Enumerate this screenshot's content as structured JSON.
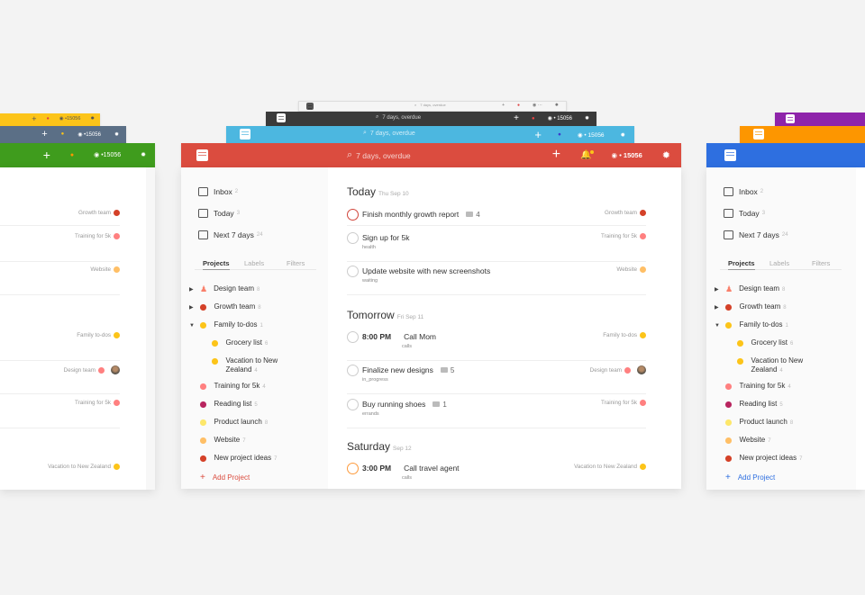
{
  "app": {
    "search_placeholder": "7 days, overdue",
    "karma": "15056",
    "karma_prefix": "•",
    "icons": [
      "logo-icon",
      "search-icon",
      "plus-icon",
      "bell-icon",
      "karma-icon",
      "gear-icon"
    ]
  },
  "theme_colors": {
    "red": "#db4c3f",
    "light": "#f5f5f5",
    "dark": "#3a3a3a",
    "sky": "#4cb7e0",
    "yellow": "#fcc419",
    "slate": "#5b6f86",
    "green": "#3f9c1d",
    "purple": "#8e24aa",
    "orange": "#fd9600",
    "blue": "#2e6fe0"
  },
  "sidebar": {
    "nav": [
      {
        "label": "Inbox",
        "count": "2",
        "icon": "inbox-icon"
      },
      {
        "label": "Today",
        "count": "3",
        "icon": "calendar-icon"
      },
      {
        "label": "Next 7 days",
        "count": "24",
        "icon": "calendar-week-icon"
      }
    ],
    "tabs": [
      "Projects",
      "Labels",
      "Filters"
    ],
    "projects": [
      {
        "label": "Design team",
        "count": "8",
        "color": "#f9806b",
        "expand": "collapsed",
        "shared": true
      },
      {
        "label": "Growth team",
        "count": "8",
        "color": "#d44128",
        "expand": "collapsed"
      },
      {
        "label": "Family to-dos",
        "count": "1",
        "color": "#fcc419",
        "expand": "expanded"
      },
      {
        "label": "Grocery list",
        "count": "6",
        "color": "#fcc419",
        "indent": true
      },
      {
        "label": "Vacation to New",
        "label2": "Zealand",
        "count": "4",
        "color": "#fcc419",
        "indent": true
      },
      {
        "label": "Training for 5k",
        "count": "4",
        "color": "#ff8080"
      },
      {
        "label": "Reading list",
        "count": "5",
        "color": "#b8255f"
      },
      {
        "label": "Product launch",
        "count": "8",
        "color": "#fde76a"
      },
      {
        "label": "Website",
        "count": "7",
        "color": "#ffbf66"
      },
      {
        "label": "New project ideas",
        "count": "7",
        "color": "#d44128"
      }
    ],
    "add_project": "Add Project"
  },
  "main": {
    "sections": [
      {
        "title": "Today",
        "date": "Thu Sep 10"
      },
      {
        "title": "Tomorrow",
        "date": "Fri Sep 11"
      },
      {
        "title": "Saturday",
        "date": "Sep 12"
      }
    ],
    "tasks": [
      {
        "title": "Finish monthly growth report",
        "comments": "4",
        "project": "Growth team",
        "color": "#d44128",
        "priority": "p1"
      },
      {
        "title": "Sign up for 5k",
        "label": "health",
        "project": "Training for 5k",
        "color": "#ff8080"
      },
      {
        "title": "Update website with new screenshots",
        "label": "waiting",
        "project": "Website",
        "color": "#ffbf66"
      },
      {
        "time": "8:00 PM",
        "title": "Call Mom",
        "label": "calls",
        "project": "Family to-dos",
        "color": "#fcc419"
      },
      {
        "title": "Finalize new designs",
        "comments": "5",
        "label": "in_progress",
        "project": "Design team",
        "color": "#ff8080",
        "assignee": "avatar"
      },
      {
        "title": "Buy running shoes",
        "comments": "1",
        "label": "errands",
        "project": "Training for 5k",
        "color": "#ff8080"
      },
      {
        "time": "3:00 PM",
        "title": "Call travel agent",
        "label": "calls",
        "project": "Vacation to New Zealand",
        "color": "#fcc419",
        "priority": "p2"
      }
    ]
  }
}
